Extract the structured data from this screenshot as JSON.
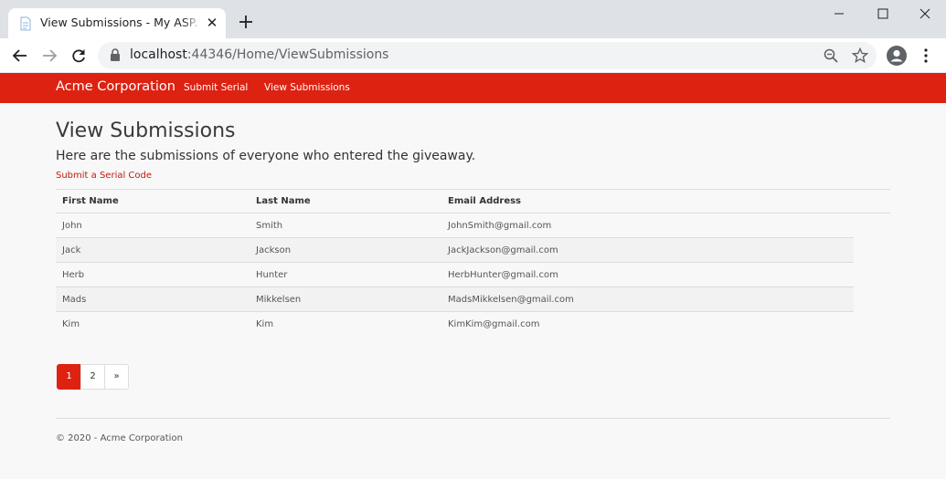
{
  "browser": {
    "tab_title": "View Submissions - My ASP.NET",
    "tab_close": "✕",
    "url_host": "localhost",
    "url_path": ":44346/Home/ViewSubmissions"
  },
  "navbar": {
    "brand": "Acme Corporation",
    "links": [
      "Submit Serial",
      "View Submissions"
    ],
    "color": "#dd2212"
  },
  "main": {
    "title": "View Submissions",
    "lead": "Here are the submissions of everyone who entered the giveaway.",
    "submit_link": "Submit a Serial Code",
    "table": {
      "headers": [
        "First Name",
        "Last Name",
        "Email Address"
      ],
      "rows": [
        [
          "John",
          "Smith",
          "JohnSmith@gmail.com"
        ],
        [
          "Jack",
          "Jackson",
          "JackJackson@gmail.com"
        ],
        [
          "Herb",
          "Hunter",
          "HerbHunter@gmail.com"
        ],
        [
          "Mads",
          "Mikkelsen",
          "MadsMikkelsen@gmail.com"
        ],
        [
          "Kim",
          "Kim",
          "KimKim@gmail.com"
        ]
      ]
    },
    "pagination": [
      "1",
      "2",
      "»"
    ],
    "current_page": "1"
  },
  "footer": {
    "text": "© 2020 - Acme Corporation"
  }
}
